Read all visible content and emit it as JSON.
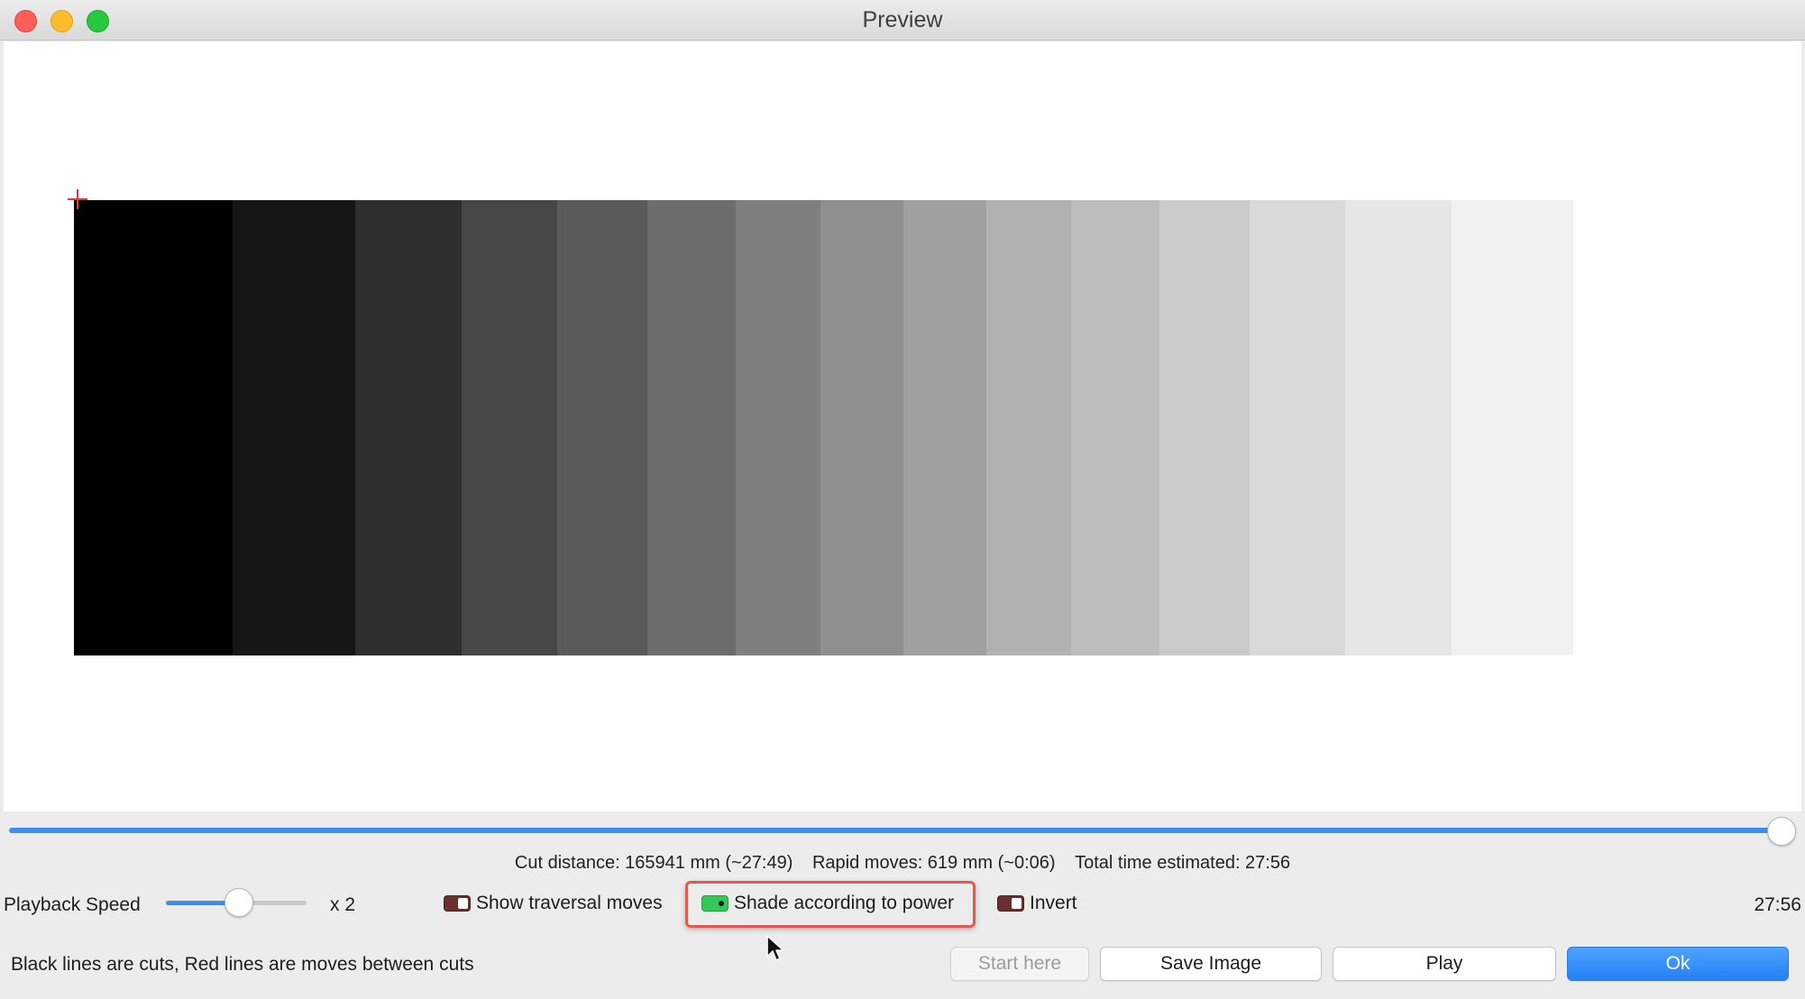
{
  "window": {
    "title": "Preview"
  },
  "preview": {
    "bands": [
      "#000000",
      "#161616",
      "#2e2e2e",
      "#474747",
      "#5a5a5a",
      "#6d6d6d",
      "#7f7f7f",
      "#8f8f8f",
      "#a0a0a0",
      "#b1b1b1",
      "#bdbdbd",
      "#cbcbcb",
      "#d9d9d9",
      "#e6e6e6",
      "#f1f1f1"
    ],
    "origin_marker_color": "#e8334a",
    "playback_progress": 1.0
  },
  "stats": {
    "cut_distance": "Cut distance: 165941 mm (~27:49)",
    "rapid_moves": "Rapid moves: 619 mm (~0:06)",
    "total_time": "Total time estimated: 27:56"
  },
  "controls": {
    "playback_speed_label": "Playback Speed",
    "playback_speed_value": "x 2",
    "playback_speed_fraction": 0.5,
    "show_traversal_moves": {
      "label": "Show traversal moves",
      "checked": false
    },
    "shade_according_to_power": {
      "label": "Shade according to power",
      "checked": true
    },
    "invert": {
      "label": "Invert",
      "checked": false
    },
    "elapsed_time": "27:56"
  },
  "footer": {
    "legend": "Black lines are cuts, Red lines are moves between cuts",
    "start_here_label": "Start here",
    "save_image_label": "Save Image",
    "play_label": "Play",
    "ok_label": "Ok"
  },
  "colors": {
    "accent": "#3b8ff0",
    "highlight": "#e8574d",
    "toggle_on": "#34c759",
    "toggle_off": "#6a2f2f"
  }
}
